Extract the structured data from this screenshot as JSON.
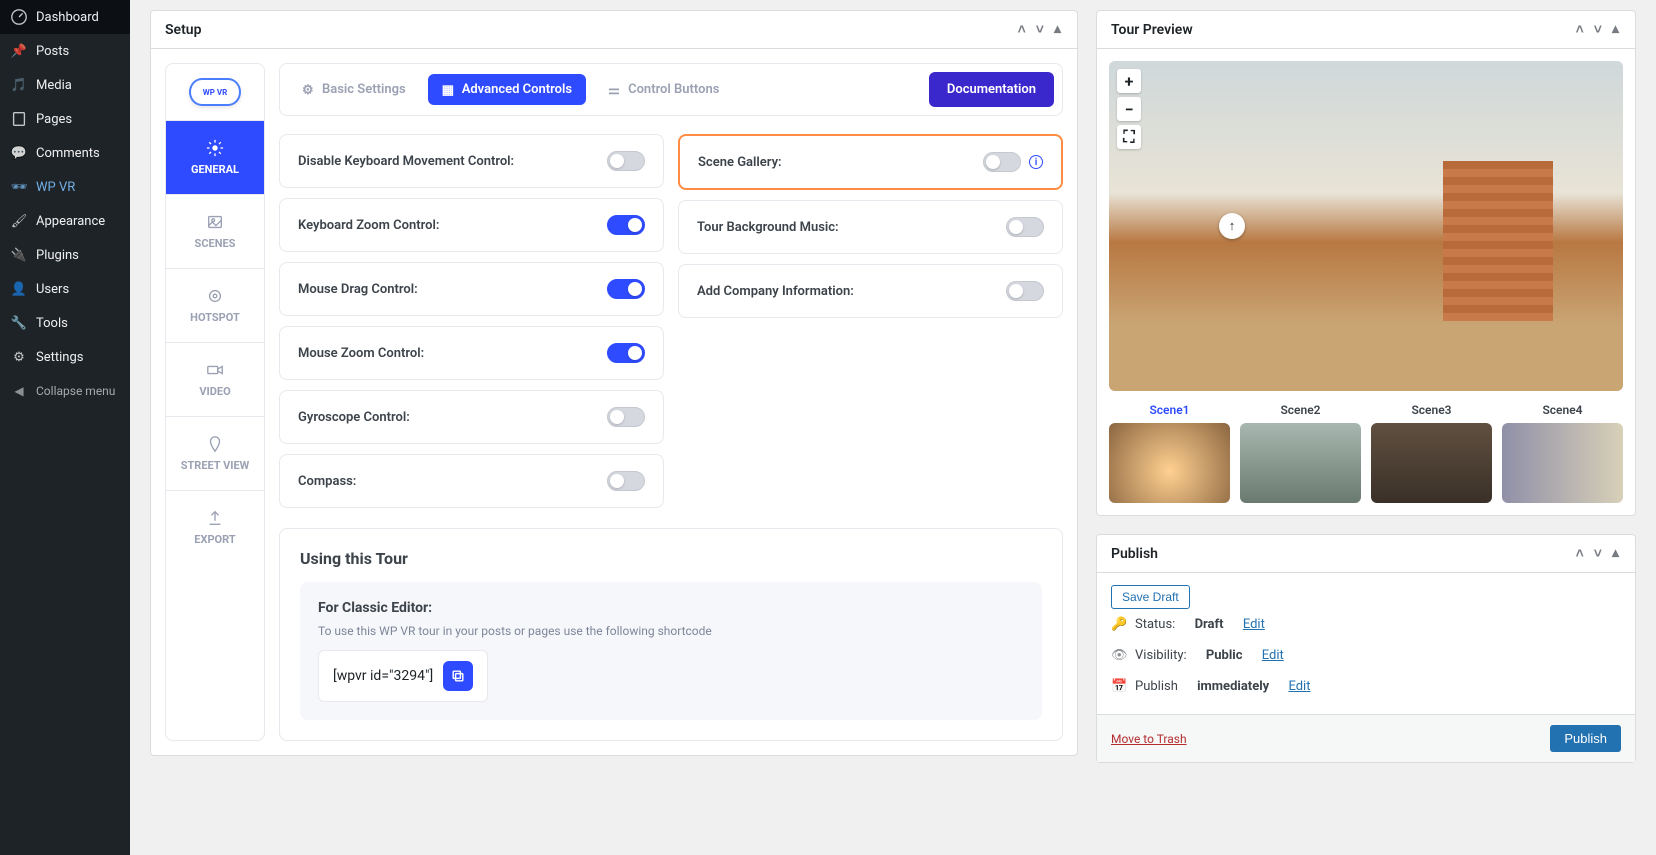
{
  "adminMenu": {
    "dashboard": "Dashboard",
    "posts": "Posts",
    "media": "Media",
    "pages": "Pages",
    "comments": "Comments",
    "wpvr": "WP VR",
    "appearance": "Appearance",
    "plugins": "Plugins",
    "users": "Users",
    "tools": "Tools",
    "settings": "Settings",
    "collapse": "Collapse menu"
  },
  "setup": {
    "title": "Setup"
  },
  "vtabs": {
    "general": "GENERAL",
    "scenes": "SCENES",
    "hotspot": "HOTSPOT",
    "video": "VIDEO",
    "street": "STREET VIEW",
    "export": "EXPORT"
  },
  "topTabs": {
    "basic": "Basic Settings",
    "advanced": "Advanced Controls",
    "control": "Control Buttons",
    "doc": "Documentation"
  },
  "logo": "WP VR",
  "settings": {
    "disableKeyboard": "Disable Keyboard Movement Control:",
    "keyboardZoom": "Keyboard Zoom Control:",
    "mouseDrag": "Mouse Drag Control:",
    "mouseZoom": "Mouse Zoom Control:",
    "gyroscope": "Gyroscope Control:",
    "compass": "Compass:",
    "sceneGallery": "Scene Gallery:",
    "bgMusic": "Tour Background Music:",
    "company": "Add Company Information:"
  },
  "using": {
    "title": "Using this Tour",
    "subtitle": "For Classic Editor:",
    "desc": "To use this WP VR tour in your posts or pages use the following shortcode",
    "shortcode": "[wpvr id=\"3294\"]"
  },
  "preview": {
    "title": "Tour Preview",
    "zoomIn": "+",
    "zoomOut": "−",
    "scenes": [
      "Scene1",
      "Scene2",
      "Scene3",
      "Scene4"
    ]
  },
  "publish": {
    "title": "Publish",
    "saveDraft": "Save Draft",
    "statusLbl": "Status:",
    "status": "Draft",
    "visLbl": "Visibility:",
    "vis": "Public",
    "pubLbl": "Publish",
    "pubVal": "immediately",
    "edit": "Edit",
    "trash": "Move to Trash",
    "btn": "Publish"
  }
}
